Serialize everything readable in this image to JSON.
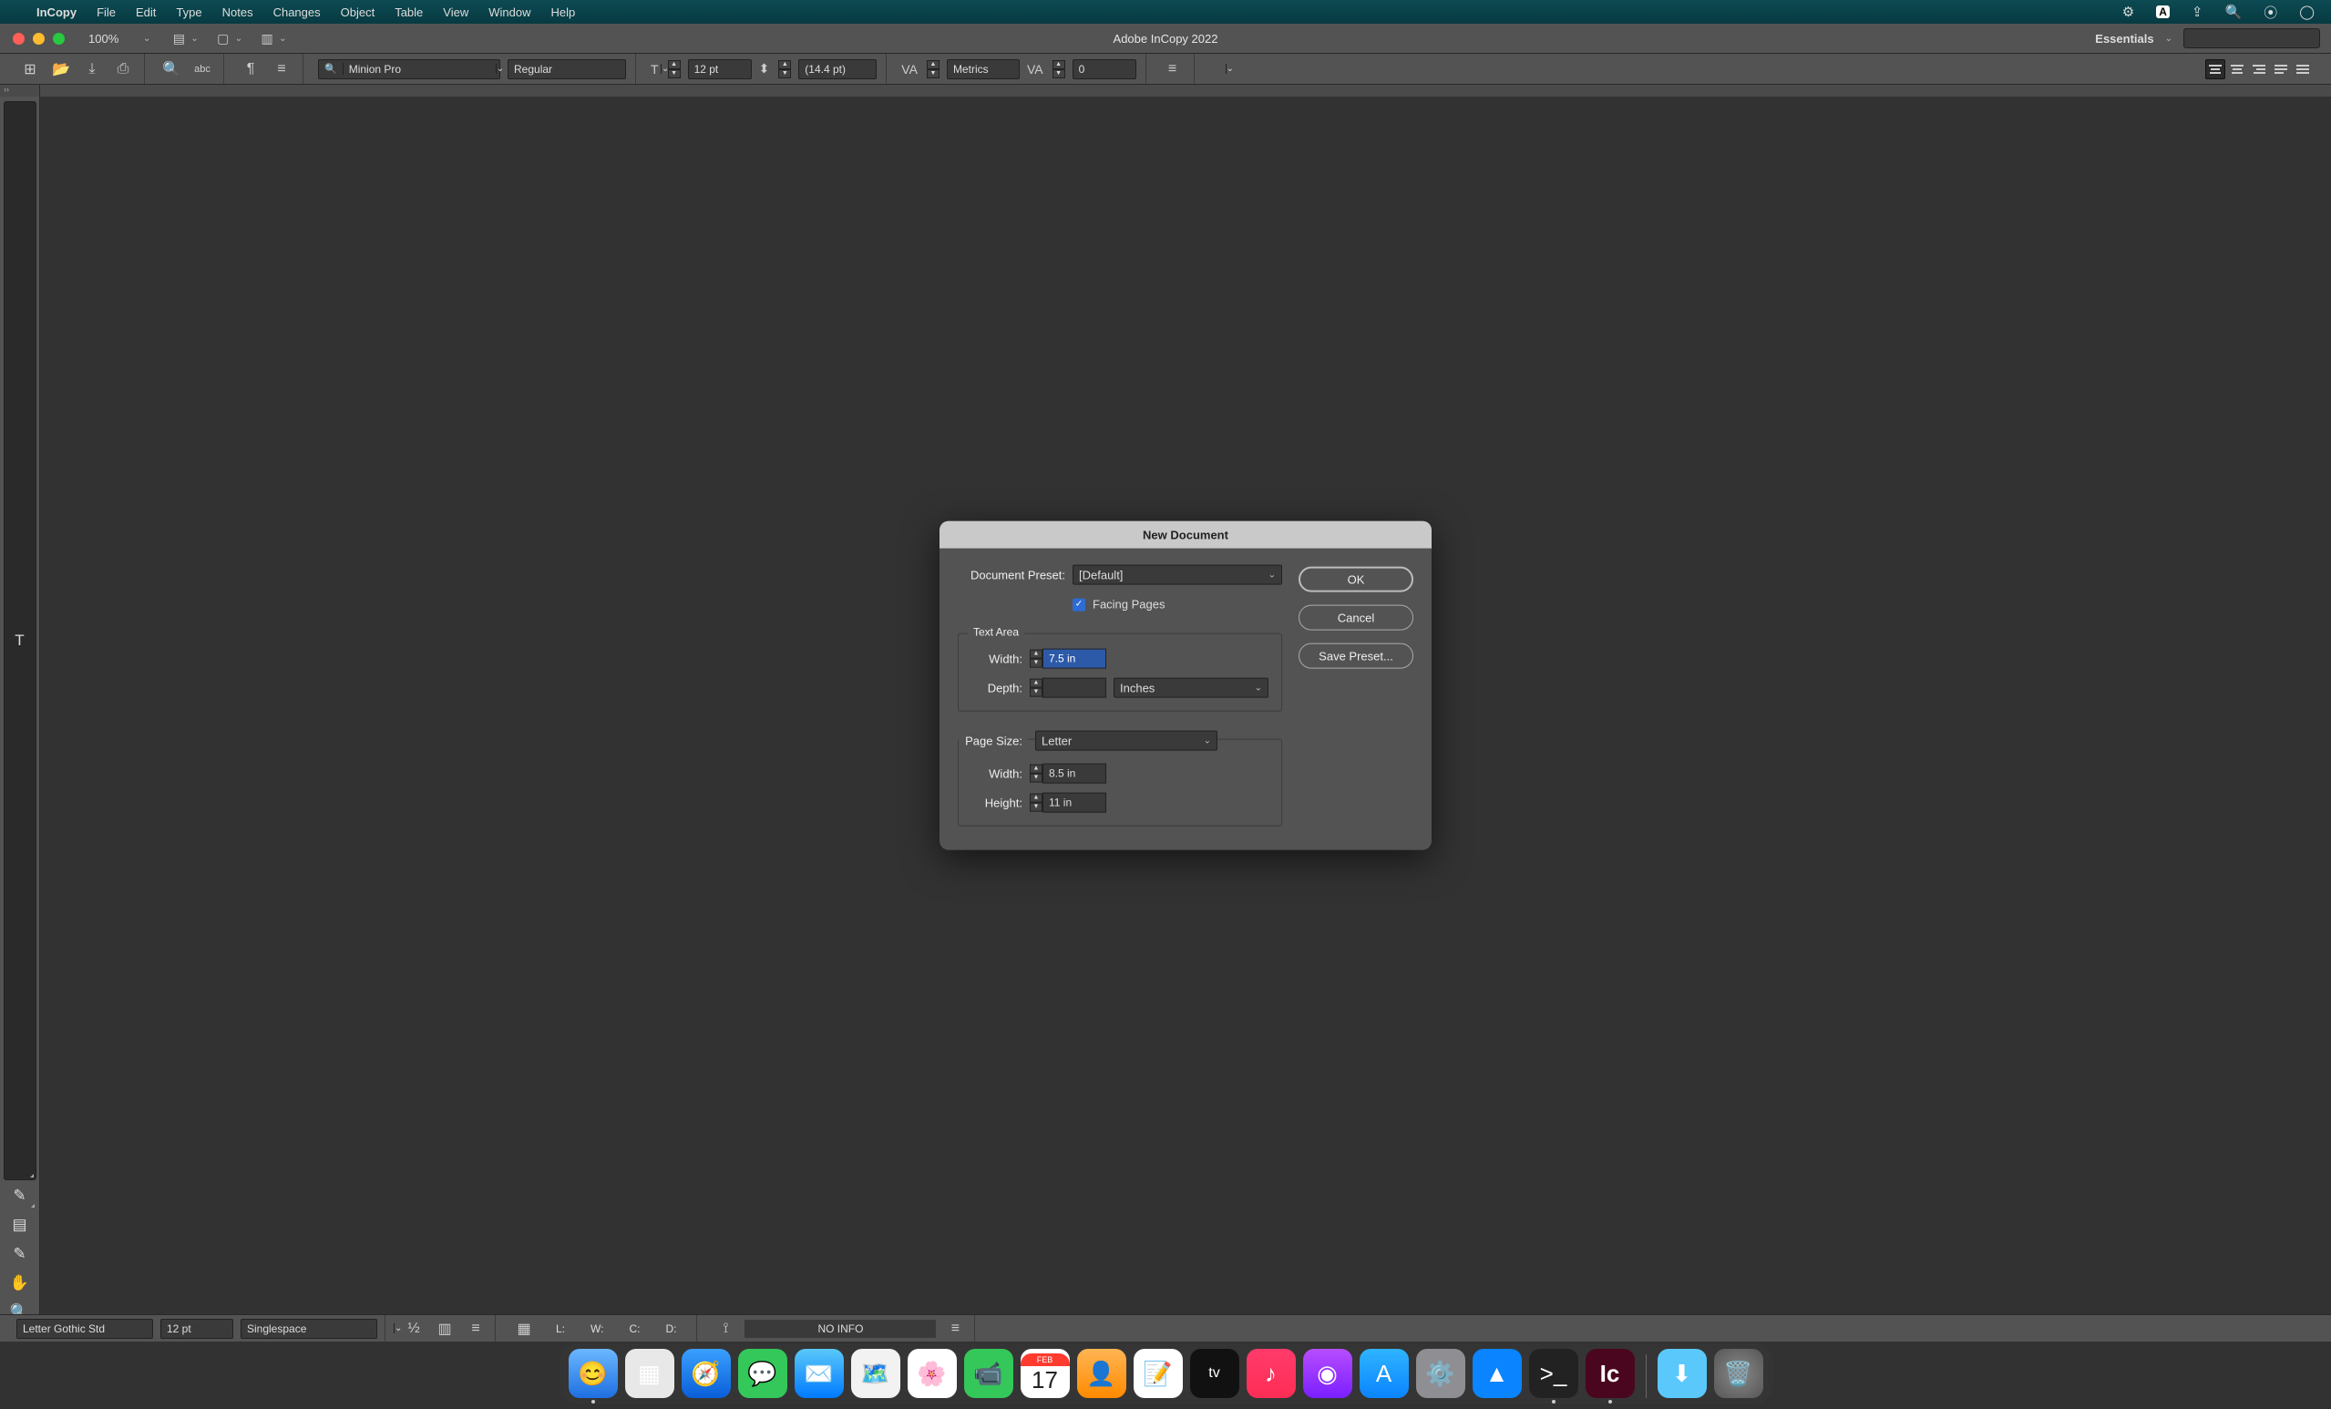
{
  "menubar": {
    "app_name": "InCopy",
    "items": [
      "File",
      "Edit",
      "Type",
      "Notes",
      "Changes",
      "Object",
      "Table",
      "View",
      "Window",
      "Help"
    ]
  },
  "titlebar": {
    "zoom": "100%",
    "app_title": "Adobe InCopy 2022",
    "workspace": "Essentials"
  },
  "optbar": {
    "font_family": "Minion Pro",
    "font_style": "Regular",
    "font_size": "12 pt",
    "leading": "(14.4 pt)",
    "kerning": "Metrics",
    "tracking": "0"
  },
  "dialog": {
    "title": "New Document",
    "preset_label": "Document Preset:",
    "preset_value": "[Default]",
    "facing_pages_label": "Facing Pages",
    "facing_pages_checked": true,
    "text_area_legend": "Text Area",
    "ta_width_label": "Width:",
    "ta_width_value": "7.5 in",
    "ta_depth_label": "Depth:",
    "ta_depth_value": "",
    "ta_depth_unit": "Inches",
    "page_size_label": "Page Size:",
    "page_size_value": "Letter",
    "ps_width_label": "Width:",
    "ps_width_value": "8.5 in",
    "ps_height_label": "Height:",
    "ps_height_value": "11 in",
    "ok": "OK",
    "cancel": "Cancel",
    "save_preset": "Save Preset..."
  },
  "botbar": {
    "font": "Letter Gothic Std",
    "size": "12 pt",
    "spacing": "Singlespace",
    "L": "L:",
    "W": "W:",
    "C": "C:",
    "D": "D:",
    "noinfo": "NO INFO"
  },
  "dock": {
    "cal_month": "FEB",
    "cal_day": "17"
  }
}
